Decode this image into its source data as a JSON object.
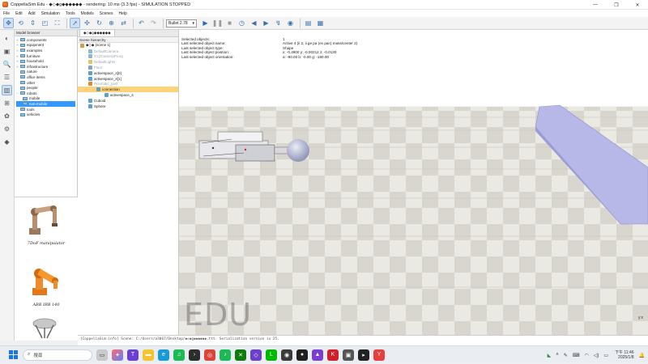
{
  "window": {
    "title": "CoppeliaSim Edu - ◆◇◆g◆◆◆◆◆◆ - rendering: 10 ms (3.3 fps) - SIMULATION STOPPED",
    "minimize": "—",
    "maximize": "❐",
    "close": "✕"
  },
  "menu": [
    "File",
    "Edit",
    "Add",
    "Simulation",
    "Tools",
    "Models",
    "Scenes",
    "Help"
  ],
  "toolbar": {
    "engine_select": "Bullet 2.78",
    "engine_caret": "▾"
  },
  "model_browser": {
    "header": "Model browser",
    "items": [
      {
        "label": "components",
        "expand": "+"
      },
      {
        "label": "equipment",
        "expand": "+"
      },
      {
        "label": "examples",
        "expand": "+"
      },
      {
        "label": "furniture",
        "expand": "+"
      },
      {
        "label": "household",
        "expand": "+"
      },
      {
        "label": "infrastructure",
        "expand": "+"
      },
      {
        "label": "nature",
        "expand": ""
      },
      {
        "label": "office items",
        "expand": ""
      },
      {
        "label": "other",
        "expand": ""
      },
      {
        "label": "people",
        "expand": ""
      },
      {
        "label": "robots",
        "expand": "−"
      },
      {
        "label": "mobile",
        "expand": "",
        "indent": true
      },
      {
        "label": "non-mobile",
        "expand": "",
        "indent": true,
        "selected": true
      },
      {
        "label": "tools",
        "expand": ""
      },
      {
        "label": "vehicles",
        "expand": ""
      }
    ],
    "thumbs": [
      {
        "label": "7DoF manipulator"
      },
      {
        "label": "ABB IRB 140"
      }
    ]
  },
  "scene_hierarchy": {
    "tab": "◆◇◆g◆◆◆◆◆◆",
    "header": "Scene hierarchy",
    "items": [
      {
        "label": "◆◇◆ (scene 1)",
        "level": 0,
        "color": "#c9a24a"
      },
      {
        "label": "DefaultCamera",
        "level": 1,
        "color": "#8fb5d6",
        "faded": true
      },
      {
        "label": "XYZCameraProxy",
        "level": 1,
        "color": "#8fb5d6",
        "faded": true
      },
      {
        "label": "DefaultLights",
        "level": 1,
        "color": "#e0c560",
        "faded": true
      },
      {
        "label": "Floor",
        "level": 1,
        "color": "#7fa4c8",
        "faded": true
      },
      {
        "label": "activespace_4[0]",
        "level": 1,
        "color": "#5aa0d0"
      },
      {
        "label": "activespace_4[1]",
        "level": 1,
        "color": "#5aa0d0"
      },
      {
        "label": "Prismatic_joint",
        "level": 1,
        "color": "#e08a2c",
        "faded": true
      },
      {
        "label": "connection",
        "level": 2,
        "color": "#5aa0d0",
        "selected": true
      },
      {
        "label": "activespace_4",
        "level": 3,
        "color": "#5aa0d0"
      },
      {
        "label": "Cuboid",
        "level": 1,
        "color": "#5aa0d0"
      },
      {
        "label": "Sphere",
        "level": 1,
        "color": "#5aa0d0"
      }
    ]
  },
  "info_overlay": [
    {
      "key": "Selected objects:",
      "value": "1"
    },
    {
      "key": "Last selected object name:",
      "value": "Active 4 (ii 2, ii ge pa (ex pan) mass/center 2)"
    },
    {
      "key": "Last selected object type:",
      "value": "Shape"
    },
    {
      "key": "Last selected object position:",
      "value": "x: -0.4900   y: -0.00212   z: -0.0130"
    },
    {
      "key": "Last selected object orientation:",
      "value": "a: -90.00   b: -0.00   g: -180.00"
    }
  ],
  "watermark": "EDU",
  "axes_label": "y x",
  "status": "[CoppeliaSim:info]  Scene: C:/Users/a3067/Desktop/◆◇◆g◆◆◆◆◆◆.ttt. Serialization version is 25.",
  "taskbar": {
    "search_placeholder": "搜尋",
    "time": "下午 11:46",
    "date": "2025/1/8"
  }
}
